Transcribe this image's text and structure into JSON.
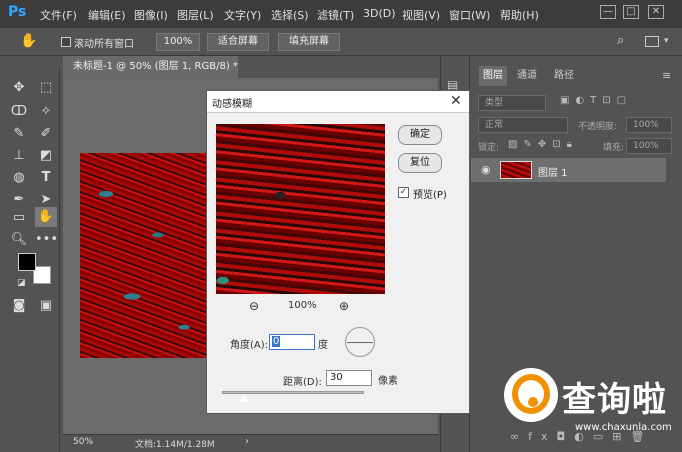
{
  "app": {
    "logo": "Ps"
  },
  "menu": [
    "文件(F)",
    "编辑(E)",
    "图像(I)",
    "图层(L)",
    "文字(Y)",
    "选择(S)",
    "滤镜(T)",
    "3D(D)",
    "视图(V)",
    "窗口(W)",
    "帮助(H)"
  ],
  "window_controls": {
    "minimize": "—",
    "restore": "□",
    "close": "✕"
  },
  "options": {
    "scroll_all_windows": "滚动所有窗口",
    "zoom_percent": "100%",
    "fit_screen": "适合屏幕",
    "fill_screen": "填充屏幕"
  },
  "document": {
    "tab_title": "未标题-1 @ 50% (图层 1, RGB/8) *",
    "tab_close": "×",
    "zoom": "50%",
    "doc_info": "文档:1.14M/1.28M"
  },
  "layers_panel": {
    "tabs": [
      "图层",
      "通道",
      "路径"
    ],
    "filter_kind": "类型",
    "blend_mode": "正常",
    "opacity_label": "不透明度:",
    "opacity_value": "100%",
    "lock_label": "锁定:",
    "fill_label": "填充:",
    "fill_value": "100%",
    "layer_name": "图层 1"
  },
  "dialog": {
    "title": "动感模糊",
    "ok": "确定",
    "reset": "复位",
    "preview_label": "预览(P)",
    "preview_checked": "✓",
    "zoom": "100%",
    "angle_label": "角度(A):",
    "angle_value": "0",
    "angle_unit": "度",
    "distance_label": "距离(D):",
    "distance_value": "30",
    "distance_unit": "像素"
  },
  "watermark": {
    "text": "查询啦",
    "url": "www.chaxunla.com"
  }
}
